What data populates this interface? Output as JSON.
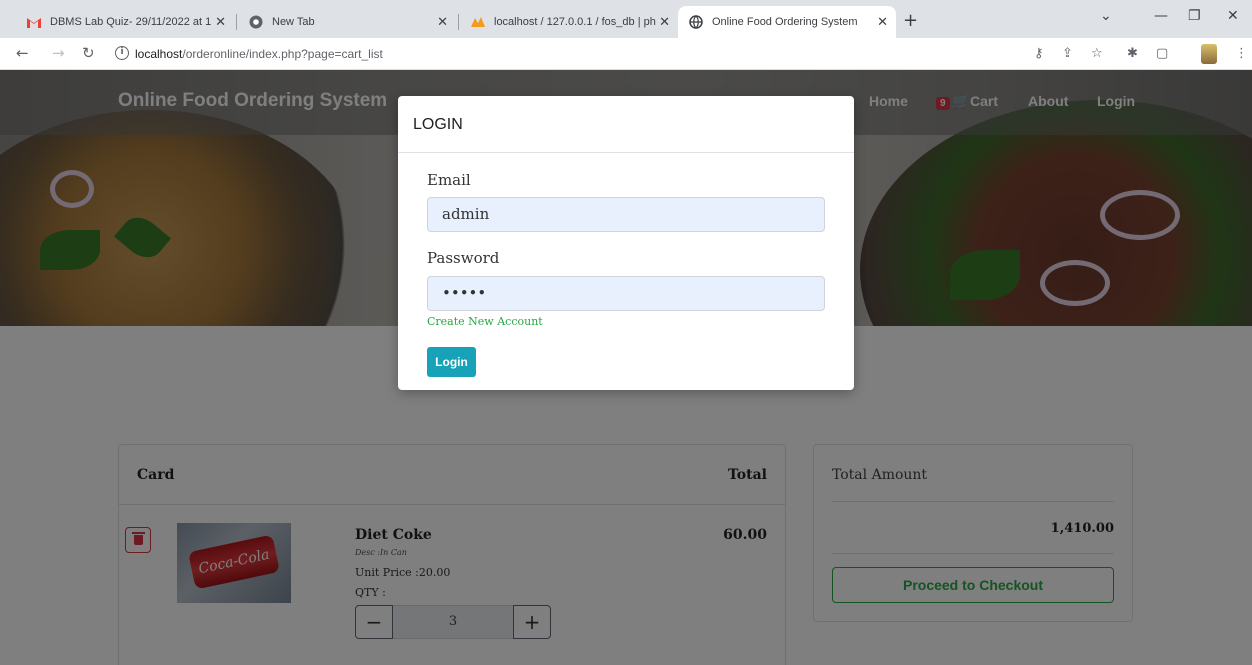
{
  "browser": {
    "tabs": [
      {
        "title": "DBMS Lab Quiz- 29/11/2022 at 1",
        "icon": "gmail-icon"
      },
      {
        "title": "New Tab",
        "icon": "chrome-icon"
      },
      {
        "title": "localhost / 127.0.0.1 / fos_db | ph",
        "icon": "phpmyadmin-icon"
      },
      {
        "title": "Online Food Ordering System",
        "icon": "globe-icon"
      }
    ],
    "active_tab": 3,
    "url_host": "localhost",
    "url_path": "/orderonline/index.php?page=cart_list"
  },
  "site": {
    "brand": "Online Food Ordering System",
    "nav": {
      "home": "Home",
      "cart_count": "9",
      "cart": "Cart",
      "about": "About",
      "login": "Login"
    }
  },
  "cart": {
    "header_card": "Card",
    "header_total": "Total",
    "items": [
      {
        "name": "Diet Coke",
        "desc": "Desc :In Can",
        "unit_price": "Unit Price :20.00",
        "qty_label": "QTY :",
        "qty": "3",
        "total": "60.00",
        "image_label": "Coca-Cola"
      }
    ],
    "summary_label": "Total Amount",
    "summary_value": "1,410.00",
    "checkout_label": "Proceed to Checkout"
  },
  "login_modal": {
    "title": "LOGIN",
    "email_label": "Email",
    "email_value": "admin",
    "password_label": "Password",
    "password_value": "•••••",
    "create_account": "Create New Account",
    "login_button": "Login"
  },
  "colors": {
    "primary": "#17a2b8",
    "success": "#28a745",
    "danger": "#dc3545",
    "autofill": "#e8f0fe"
  }
}
